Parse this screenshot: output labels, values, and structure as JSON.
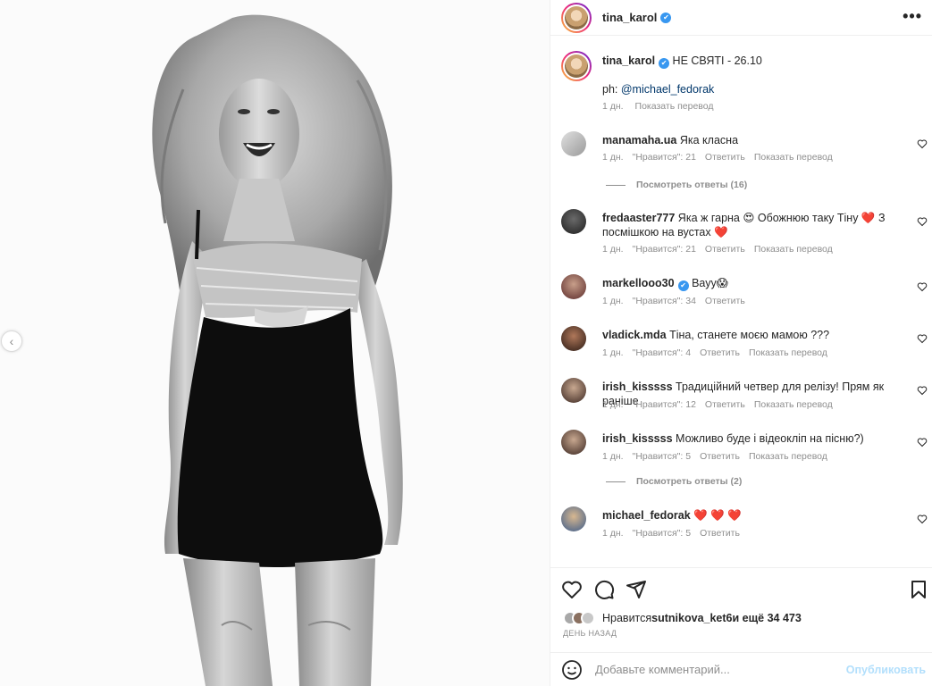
{
  "post": {
    "author": "tina_karol",
    "caption_text": "НЕ СВЯТІ - 26.10",
    "caption_credit_prefix": "ph: ",
    "caption_credit_link": "@michael_fedorak",
    "caption_time": "1 дн.",
    "caption_translate": "Показать перевод"
  },
  "icons": {
    "verified": "✔",
    "more": "•••",
    "carousel_prev": "‹"
  },
  "comments": [
    {
      "user": "manamaha.ua",
      "text": "Яка класна",
      "time": "1 дн.",
      "likes": "\"Нравится\": 21",
      "reply": "Ответить",
      "translate": "Показать перевод",
      "verified": false,
      "view_replies": "Посмотреть ответы (16)"
    },
    {
      "user": "fredaaster777",
      "text": "Яка ж гарна 😍 Обожнюю таку Тіну ❤️ З посмішкою на вустах ❤️",
      "time": "1 дн.",
      "likes": "\"Нравится\": 21",
      "reply": "Ответить",
      "translate": "Показать перевод",
      "verified": false
    },
    {
      "user": "markellooo30",
      "text": "Вауу😱",
      "time": "1 дн.",
      "likes": "\"Нравится\": 34",
      "reply": "Ответить",
      "verified": true
    },
    {
      "user": "vladick.mda",
      "text": "Тіна, станете моєю мамою ???",
      "time": "1 дн.",
      "likes": "\"Нравится\": 4",
      "reply": "Ответить",
      "translate": "Показать перевод",
      "verified": false
    },
    {
      "user": "irish_kisssss",
      "text": "Традиційний четвер для релізу! Прям як раніше",
      "time": "1 дн.",
      "likes": "\"Нравится\": 12",
      "reply": "Ответить",
      "translate": "Показать перевод",
      "verified": false
    },
    {
      "user": "irish_kisssss",
      "text": "Можливо буде і відеокліп на пісню?)",
      "time": "1 дн.",
      "likes": "\"Нравится\": 5",
      "reply": "Ответить",
      "translate": "Показать перевод",
      "verified": false,
      "view_replies": "Посмотреть ответы (2)"
    },
    {
      "user": "michael_fedorak",
      "text": "❤️ ❤️ ❤️",
      "time": "1 дн.",
      "likes": "\"Нравится\": 5",
      "reply": "Ответить",
      "verified": false
    }
  ],
  "likes_summary": {
    "prefix": "Нравится ",
    "user": "sutnikova_ket6",
    "suffix": " и ещё 34 473"
  },
  "post_date": "ДЕНЬ НАЗАД",
  "add_comment": {
    "placeholder": "Добавьте комментарий...",
    "publish_label": "Опубликовать"
  }
}
